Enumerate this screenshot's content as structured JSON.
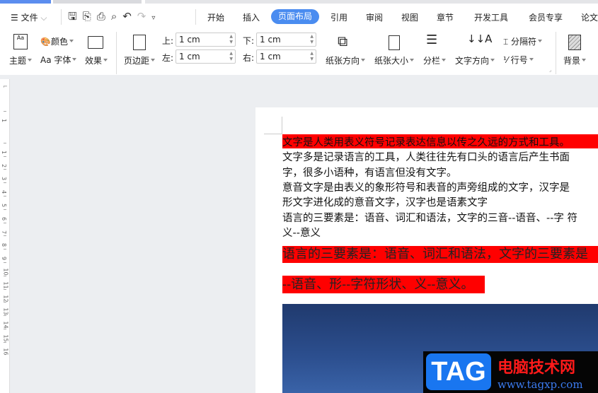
{
  "menu": {
    "file": "文件",
    "tabs": [
      "开始",
      "插入",
      "页面布局",
      "引用",
      "审阅",
      "视图",
      "章节",
      "开发工具",
      "会员专享",
      "论文"
    ],
    "active_tab": "页面布局"
  },
  "ribbon": {
    "theme": "主题",
    "color": "颜色",
    "font": "字体",
    "font_prefix": "Aa",
    "effect": "效果",
    "margins": "页边距",
    "top_label": "上:",
    "top": "1 cm",
    "bottom_label": "下:",
    "bottom": "1 cm",
    "left_label": "左:",
    "left": "1 cm",
    "right_label": "右:",
    "right": "1 cm",
    "orientation": "纸张方向",
    "size": "纸张大小",
    "columns": "分栏",
    "text_direction": "文字方向",
    "breaks": "分隔符",
    "line_numbers": "行号",
    "background": "背景"
  },
  "ruler": [
    "1",
    "1",
    "2",
    "3",
    "4",
    "5",
    "6",
    "7",
    "8",
    "9",
    "10",
    "11",
    "12",
    "13",
    "14",
    "15",
    "16"
  ],
  "document": {
    "lines": [
      "文字是人类用表义符号记录表达信息以传之久远的方式和工具。",
      "文字多是记录语言的工具，人类往往先有口头的语言后产生书面",
      "字，很多小语种，有语言但没有文字。",
      "意音文字是由表义的象形符号和表音的声旁组成的文字，汉字是",
      "形文字进化成的意音文字，汉字也是语素文字",
      "语言的三要素是：语音、词汇和语法，文字的三音--语音、--字 符",
      "义--意义"
    ],
    "big_lines": [
      "语言的三要素是：语音、词汇和语法，文字的三要素是",
      "--语音、形--字符形状、义--意义。"
    ]
  },
  "watermark": {
    "tag": "TAG",
    "cn": "电脑技术网",
    "url": "www.tagxp.com"
  },
  "colors": {
    "accent": "#4a8cf0",
    "highlight": "#ff0000"
  }
}
